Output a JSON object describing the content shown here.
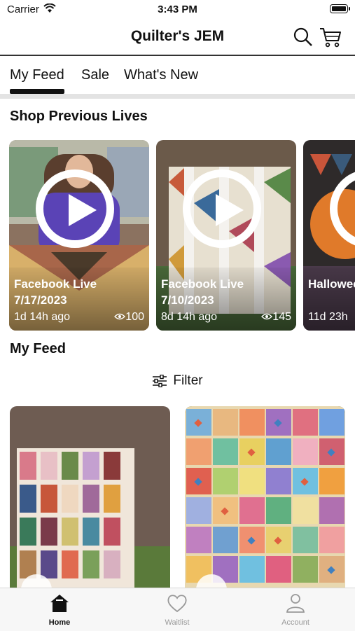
{
  "status_bar": {
    "carrier": "Carrier",
    "time": "3:43 PM"
  },
  "header": {
    "title": "Quilter's JEM"
  },
  "tabs": [
    {
      "label": "My Feed",
      "active": true
    },
    {
      "label": "Sale"
    },
    {
      "label": "What's New"
    }
  ],
  "sections": {
    "shop_previous_lives": "Shop Previous Lives",
    "my_feed": "My Feed"
  },
  "lives": [
    {
      "title": "Facebook Live",
      "date": "7/17/2023",
      "ago": "1d 14h ago",
      "views": "100"
    },
    {
      "title": "Facebook Live",
      "date": "7/10/2023",
      "ago": "8d 14h ago",
      "views": "145"
    },
    {
      "title": "Hallowee",
      "ago": "11d 23h"
    }
  ],
  "filter": {
    "label": "Filter"
  },
  "tab_bar": [
    {
      "label": "Home",
      "active": true
    },
    {
      "label": "Waitlist"
    },
    {
      "label": "Account"
    }
  ],
  "colors": {
    "accent": "#111111",
    "inactive": "#999999"
  }
}
